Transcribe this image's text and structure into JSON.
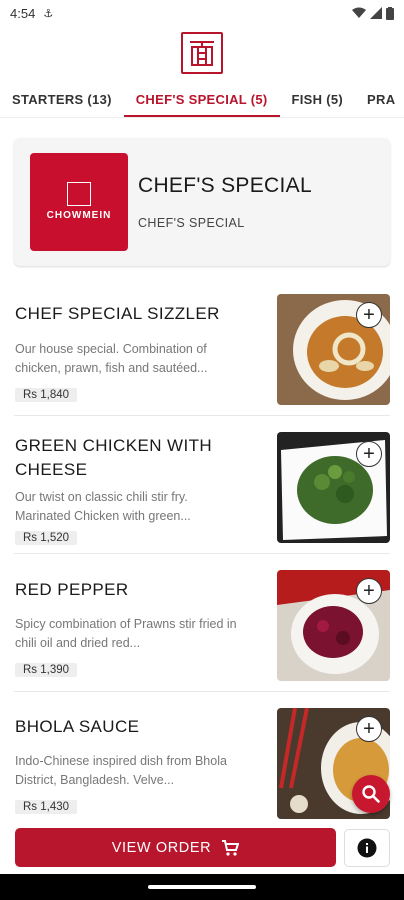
{
  "status": {
    "time": "4:54"
  },
  "tabs": [
    {
      "label": "STARTERS (13)"
    },
    {
      "label": "CHEF'S SPECIAL (5)"
    },
    {
      "label": "FISH (5)"
    },
    {
      "label": "PRA"
    }
  ],
  "category": {
    "title": "CHEF'S SPECIAL",
    "subtitle": "CHEF'S SPECIAL",
    "brand": "CHOWMEIN"
  },
  "items": [
    {
      "name": "CHEF SPECIAL SIZZLER",
      "desc": "Our house special. Combination of chicken, prawn, fish and sautéed...",
      "price": "Rs 1,840"
    },
    {
      "name": "GREEN CHICKEN WITH CHEESE",
      "desc": "Our twist on classic chili stir fry. Marinated Chicken with green...",
      "price": "Rs 1,520"
    },
    {
      "name": "RED PEPPER",
      "desc": "Spicy combination of Prawns stir fried in chili oil and dried red...",
      "price": "Rs 1,390"
    },
    {
      "name": "BHOLA SAUCE",
      "desc": "Indo-Chinese inspired dish from Bhola District, Bangladesh. Velve...",
      "price": "Rs 1,430"
    }
  ],
  "actions": {
    "view_order": "VIEW ORDER"
  },
  "colors": {
    "accent": "#b8142b"
  }
}
